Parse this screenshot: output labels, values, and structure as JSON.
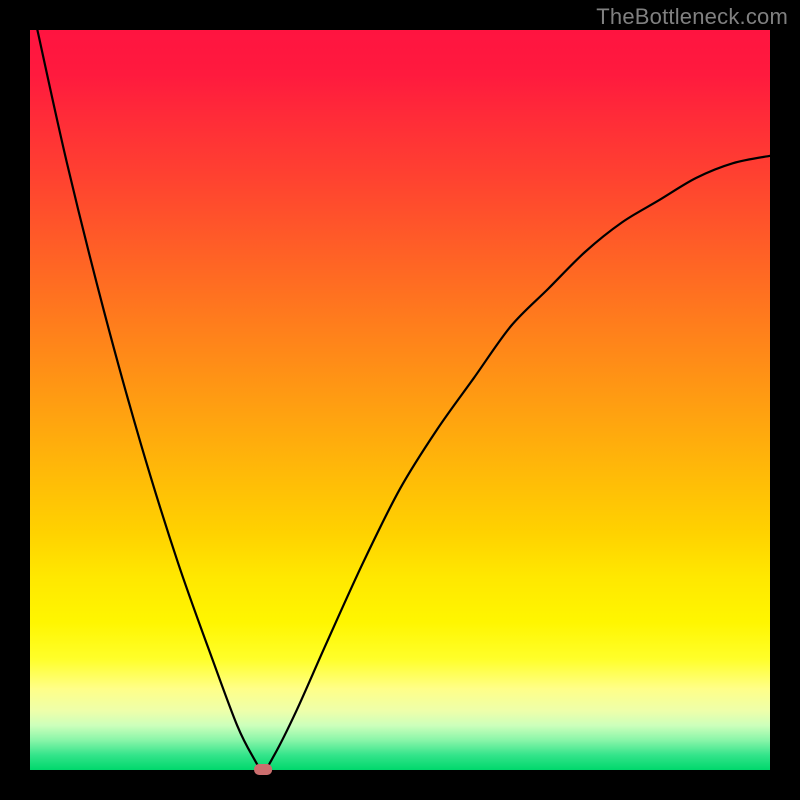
{
  "attribution": "TheBottleneck.com",
  "chart_data": {
    "type": "line",
    "title": "",
    "xlabel": "",
    "ylabel": "",
    "xlim": [
      0,
      100
    ],
    "ylim": [
      0,
      100
    ],
    "background": "vertical-gradient red→orange→yellow→green (top→bottom)",
    "series": [
      {
        "name": "bottleneck-curve",
        "x": [
          1,
          5,
          10,
          15,
          20,
          25,
          28,
          30,
          31.5,
          33,
          36,
          40,
          45,
          50,
          55,
          60,
          65,
          70,
          75,
          80,
          85,
          90,
          95,
          100
        ],
        "values": [
          100,
          82,
          62,
          44,
          28,
          14,
          6,
          2,
          0,
          2,
          8,
          17,
          28,
          38,
          46,
          53,
          60,
          65,
          70,
          74,
          77,
          80,
          82,
          83
        ]
      }
    ],
    "marker": {
      "x": 31.5,
      "y": 0,
      "shape": "rounded-rect",
      "color": "#cc6e6e"
    }
  }
}
